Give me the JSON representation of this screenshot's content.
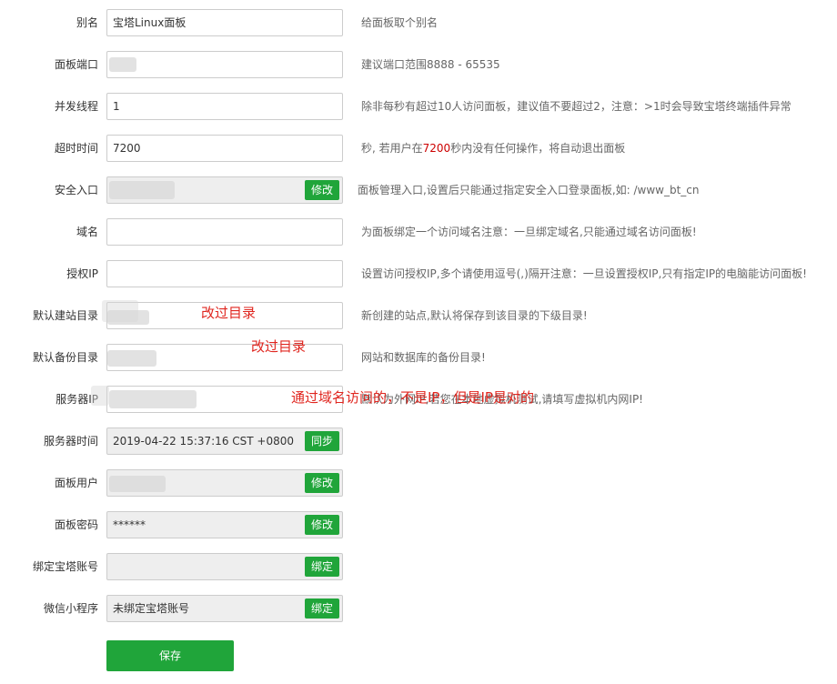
{
  "fields": {
    "alias": {
      "label": "别名",
      "value": "宝塔Linux面板",
      "desc": "给面板取个别名"
    },
    "port": {
      "label": "面板端口",
      "value": "",
      "desc": "建议端口范围8888 - 65535"
    },
    "threads": {
      "label": "并发线程",
      "value": "1",
      "desc": "除非每秒有超过10人访问面板，建议值不要超过2，注意：>1时会导致宝塔终端插件异常"
    },
    "timeout": {
      "label": "超时时间",
      "value": "7200",
      "desc_pre": "秒, 若用户在",
      "desc_hl": "7200",
      "desc_post": "秒内没有任何操作，将自动退出面板"
    },
    "entry": {
      "label": "安全入口",
      "value": "",
      "button": "修改",
      "desc": "面板管理入口,设置后只能通过指定安全入口登录面板,如: /www_bt_cn"
    },
    "domain": {
      "label": "域名",
      "value": "",
      "desc": "为面板绑定一个访问域名注意：一旦绑定域名,只能通过域名访问面板!"
    },
    "auth_ip": {
      "label": "授权IP",
      "value": "",
      "desc": "设置访问授权IP,多个请使用逗号(,)隔开注意：一旦设置授权IP,只有指定IP的电脑能访问面板!"
    },
    "site_dir": {
      "label": "默认建站目录",
      "value": "",
      "desc": "新创建的站点,默认将保存到该目录的下级目录!"
    },
    "backup_dir": {
      "label": "默认备份目录",
      "value": "",
      "desc": "网站和数据库的备份目录!"
    },
    "server_ip": {
      "label": "服务器IP",
      "value": "",
      "desc": "默认为外网IP,若您在本地虚拟机测试,请填写虚拟机内网IP!"
    },
    "server_time": {
      "label": "服务器时间",
      "value": "2019-04-22 15:37:16 CST +0800",
      "button": "同步"
    },
    "panel_user": {
      "label": "面板用户",
      "value": "",
      "button": "修改"
    },
    "panel_pass": {
      "label": "面板密码",
      "value": "******",
      "button": "修改"
    },
    "bt_account": {
      "label": "绑定宝塔账号",
      "value": "",
      "button": "绑定"
    },
    "wechat": {
      "label": "微信小程序",
      "value": "未绑定宝塔账号",
      "button": "绑定"
    }
  },
  "save_label": "保存",
  "annotations": {
    "note1": "改过目录",
    "note2": "改过目录",
    "note3": "通过域名访问的，不是IP，但是IP是对的"
  },
  "colors": {
    "accent": "#20a53a",
    "annotation": "#e0261f",
    "highlight": "#cc0000"
  }
}
